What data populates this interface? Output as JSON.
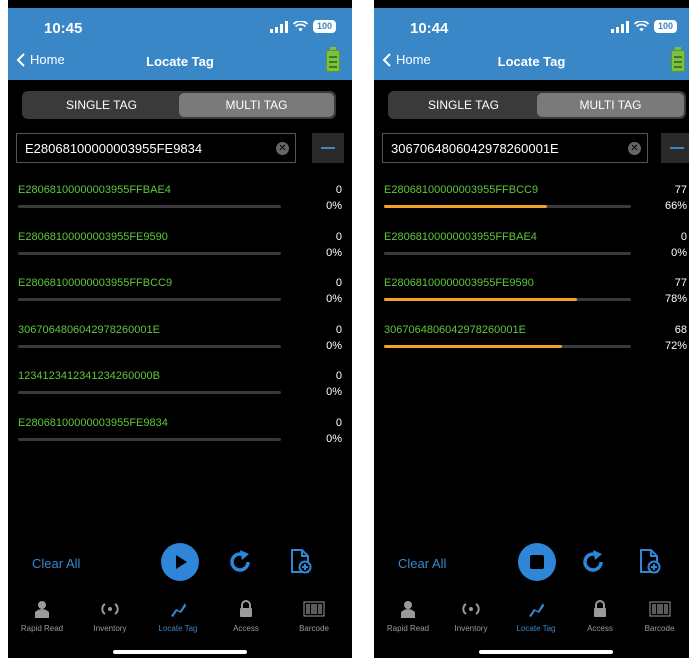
{
  "left": {
    "status_time": "10:45",
    "battery": "100",
    "back_label": "Home",
    "title": "Locate Tag",
    "segments": [
      "SINGLE TAG",
      "MULTI TAG"
    ],
    "search_value": "E28068100000003955FE9834",
    "tags": [
      {
        "id": "E28068100000003955FFBAE4",
        "count": "0",
        "percent": "0%",
        "progress": 0
      },
      {
        "id": "E28068100000003955FE9590",
        "count": "0",
        "percent": "0%",
        "progress": 0
      },
      {
        "id": "E28068100000003955FFBCC9",
        "count": "0",
        "percent": "0%",
        "progress": 0
      },
      {
        "id": "3067064806042978260001E",
        "count": "0",
        "percent": "0%",
        "progress": 0
      },
      {
        "id": "1234123412341234260000B",
        "count": "0",
        "percent": "0%",
        "progress": 0
      },
      {
        "id": "E28068100000003955FE9834",
        "count": "0",
        "percent": "0%",
        "progress": 0
      }
    ],
    "clear_all": "Clear All",
    "scan_state": "play"
  },
  "right": {
    "status_time": "10:44",
    "battery": "100",
    "back_label": "Home",
    "title": "Locate Tag",
    "segments": [
      "SINGLE TAG",
      "MULTI TAG"
    ],
    "search_value": "3067064806042978260001E",
    "tags": [
      {
        "id": "E28068100000003955FFBCC9",
        "count": "77",
        "percent": "66%",
        "progress": 0.66
      },
      {
        "id": "E28068100000003955FFBAE4",
        "count": "0",
        "percent": "0%",
        "progress": 0
      },
      {
        "id": "E28068100000003955FE9590",
        "count": "77",
        "percent": "78%",
        "progress": 0.78
      },
      {
        "id": "3067064806042978260001E",
        "count": "68",
        "percent": "72%",
        "progress": 0.72
      }
    ],
    "clear_all": "Clear All",
    "scan_state": "stop"
  },
  "tabs": [
    "Rapid Read",
    "Inventory",
    "Locate Tag",
    "Access",
    "Barcode"
  ],
  "active_tab": "Locate Tag",
  "colors": {
    "accent": "#3a87c8",
    "tag_id": "#5ec73a",
    "progress": "#f0a22a"
  }
}
